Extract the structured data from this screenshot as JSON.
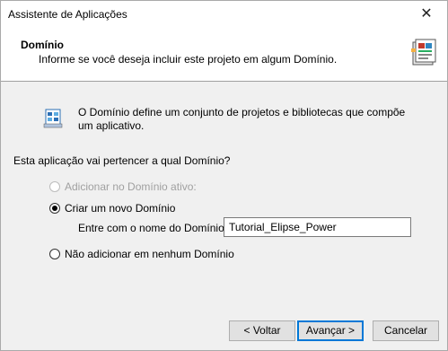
{
  "window": {
    "title": "Assistente de Aplicações",
    "close_glyph": "✕"
  },
  "header": {
    "title": "Domínio",
    "subtitle": "Informe se você deseja incluir este projeto em algum Domínio.",
    "icon": "wizard-document-icon"
  },
  "info": {
    "icon": "domain-info-icon",
    "text": "O Domínio define um conjunto de projetos e bibliotecas que compõe um aplicativo."
  },
  "question": "Esta aplicação vai pertencer a qual Domínio?",
  "options": {
    "active": {
      "label": "Adicionar no Domínio ativo:",
      "selected": false,
      "enabled": false
    },
    "new": {
      "label": "Criar um novo Domínio",
      "selected": true,
      "enabled": true
    },
    "none": {
      "label": "Não adicionar em nenhum Domínio",
      "selected": false,
      "enabled": true
    }
  },
  "new_domain": {
    "label": "Entre com o nome do Domínio:",
    "value": "Tutorial_Elipse_Power"
  },
  "buttons": {
    "back": "< Voltar",
    "next": "Avançar >",
    "cancel": "Cancelar"
  },
  "colors": {
    "accent": "#0078d7",
    "header_bg": "#ffffff",
    "body_bg": "#f0f0f0"
  }
}
